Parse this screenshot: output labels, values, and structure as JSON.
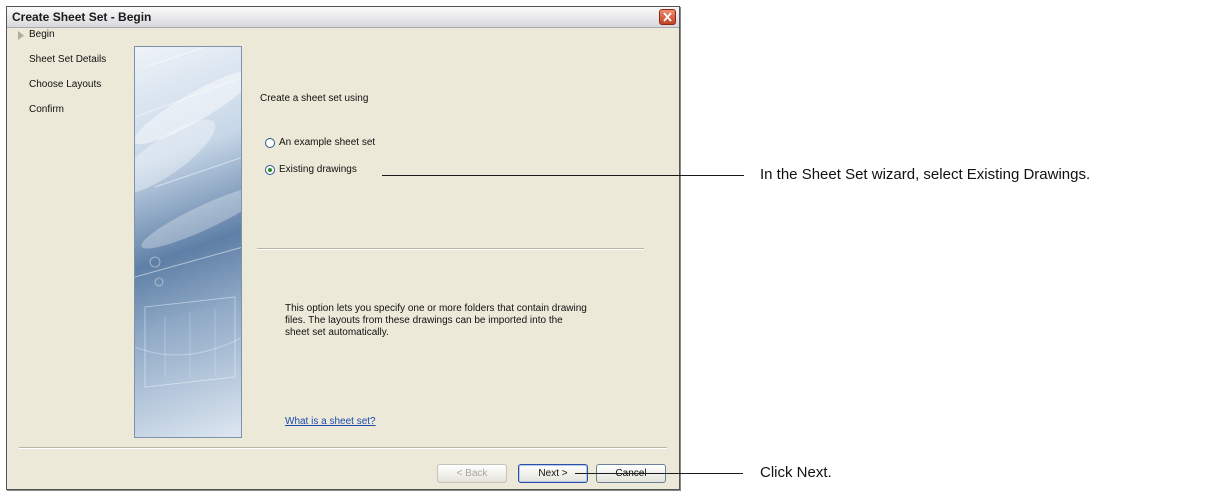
{
  "window": {
    "title": "Create Sheet Set - Begin"
  },
  "nav": {
    "items": [
      {
        "label": "Begin"
      },
      {
        "label": "Sheet Set Details"
      },
      {
        "label": "Choose Layouts"
      },
      {
        "label": "Confirm"
      }
    ],
    "current": "Begin"
  },
  "main": {
    "heading": "Create a sheet set using",
    "options": [
      {
        "label": "An example sheet set",
        "selected": false
      },
      {
        "label": "Existing drawings",
        "selected": true
      }
    ],
    "description": "This option lets you specify one or more folders that contain drawing\nfiles.  The layouts from these drawings can be imported into the\nsheet set automatically.",
    "help_link": "What is a sheet set?"
  },
  "buttons": {
    "back": "< Back",
    "next": "Next >",
    "cancel": "Cancel"
  },
  "callouts": {
    "select_drawings": "In the Sheet Set wizard, select Existing Drawings.",
    "click_next": "Click Next."
  },
  "icons": {
    "close": "close-icon",
    "current_step": "current-step-arrow-icon",
    "radio_selected_color": "#2a8a2a"
  }
}
